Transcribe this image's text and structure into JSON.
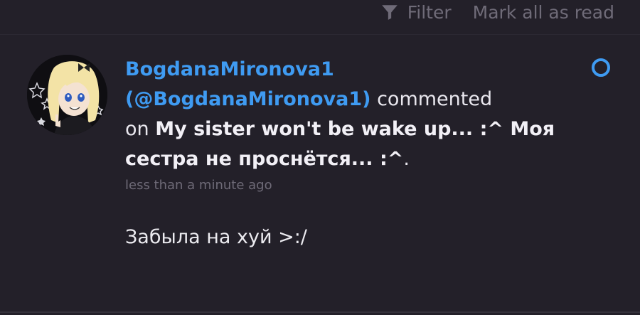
{
  "toolbar": {
    "filter_label": "Filter",
    "filter_icon": "filter-icon",
    "mark_all_read_label": "Mark all as read"
  },
  "notification": {
    "username": "BogdanaMironova1",
    "handle": "(@BogdanaMironova1)",
    "action_text": " commented",
    "on_text": "on ",
    "post_title": "My sister won't be wake up... :^ Моя сестра не проснётся... :^",
    "title_end": ".",
    "timestamp": "less than a minute ago",
    "comment": "Забыла на хуй >:/",
    "unread": true
  },
  "colors": {
    "background": "#232029",
    "accent": "#3f9bf2",
    "muted": "#6f6b78",
    "text": "#e9e7ee"
  }
}
